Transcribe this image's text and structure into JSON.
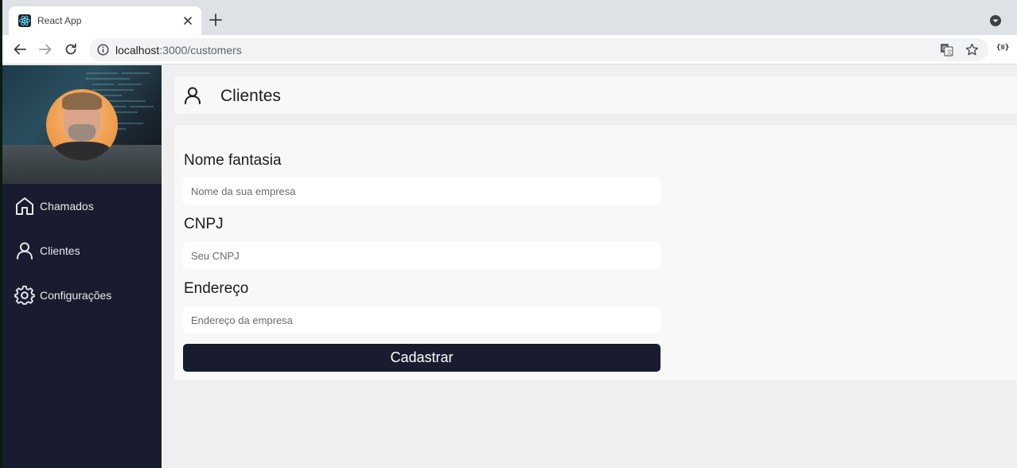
{
  "browser": {
    "tab_title": "React App",
    "url_host": "localhost",
    "url_path": ":3000/customers",
    "extension_label": "{≡}"
  },
  "sidebar": {
    "items": [
      {
        "label": "Chamados",
        "icon": "home-icon"
      },
      {
        "label": "Clientes",
        "icon": "user-icon"
      },
      {
        "label": "Configurações",
        "icon": "gear-icon"
      }
    ]
  },
  "header": {
    "title": "Clientes",
    "icon": "user-icon"
  },
  "form": {
    "fields": [
      {
        "label": "Nome fantasia",
        "placeholder": "Nome da sua empresa"
      },
      {
        "label": "CNPJ",
        "placeholder": "Seu CNPJ"
      },
      {
        "label": "Endereço",
        "placeholder": "Endereço da empresa"
      }
    ],
    "submit_label": "Cadastrar"
  },
  "colors": {
    "sidebar_bg": "#181c2e",
    "button_bg": "#181c2e",
    "page_bg": "#efefef",
    "card_bg": "#f8f8f8"
  }
}
